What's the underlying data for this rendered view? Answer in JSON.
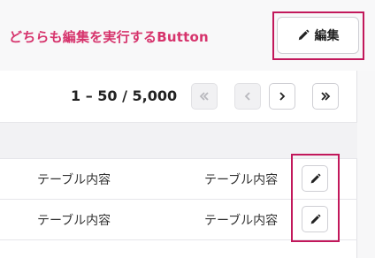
{
  "annotation": {
    "text": "どちらも編集を実行するButton",
    "color": "#d6336c"
  },
  "toolbar": {
    "edit_label": "編集",
    "edit_icon": "pencil-icon"
  },
  "pagination": {
    "range_text": "1 – 50 / 5,000",
    "buttons": [
      {
        "name": "first-page",
        "icon": "double-chevron-left-icon",
        "disabled": true
      },
      {
        "name": "prev-page",
        "icon": "chevron-left-icon",
        "disabled": true
      },
      {
        "name": "next-page",
        "icon": "chevron-right-icon",
        "disabled": false
      },
      {
        "name": "last-page",
        "icon": "double-chevron-right-icon",
        "disabled": false
      }
    ]
  },
  "table": {
    "rows": [
      {
        "col1": "テーブル内容",
        "col2": "テーブル内容",
        "action_icon": "pencil-icon"
      },
      {
        "col1": "テーブル内容",
        "col2": "テーブル内容",
        "action_icon": "pencil-icon"
      }
    ]
  },
  "colors": {
    "highlight": "#c2185b",
    "annotation": "#d6336c"
  }
}
